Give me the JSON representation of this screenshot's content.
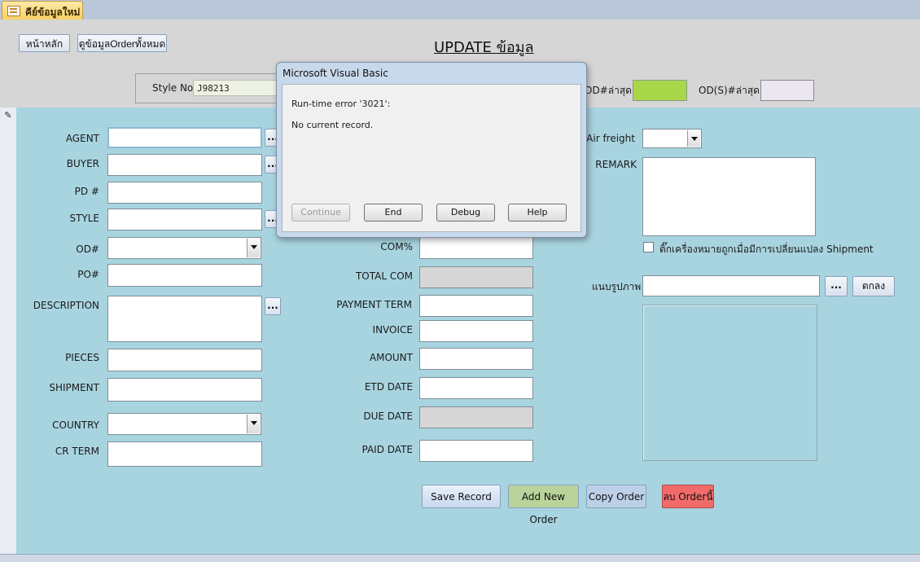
{
  "tabs": {
    "active_label": "คีย์ข้อมูลใหม่"
  },
  "header": {
    "home_button": "หน้าหลัก",
    "view_orders_button": "ดูข้อมูลOrderทั้งหมด",
    "page_title": "UPDATE ข้อมูล",
    "style_label": "Style No.",
    "style_value": "J98213",
    "od_last_label": "OD#ล่าสุด",
    "ods_last_label": "OD(S)#ล่าสุด"
  },
  "form": {
    "left": {
      "agent_label": "AGENT",
      "buyer_label": "BUYER",
      "pd_label": "PD #",
      "style_label": "STYLE",
      "od_label": "OD#",
      "po_label": "PO#",
      "description_label": "DESCRIPTION",
      "pieces_label": "PIECES",
      "shipment_label": "SHIPMENT",
      "country_label": "COUNTRY",
      "cr_term_label": "CR TERM"
    },
    "middle": {
      "com_pct_label": "COM%",
      "total_com_label": "TOTAL COM",
      "payment_term_label": "PAYMENT TERM",
      "invoice_label": "INVOICE",
      "amount_label": "AMOUNT",
      "etd_date_label": "ETD DATE",
      "due_date_label": "DUE DATE",
      "paid_date_label": "PAID DATE"
    },
    "right": {
      "air_freight_label": "Air freight",
      "remark_label": "REMARK",
      "shipment_change_checkbox_label": "ติ๊กเครื่องหมายถูกเมื่อมีการเปลี่ยนแปลง Shipment",
      "attach_image_label": "แนบรูปภาพ",
      "browse_label": "...",
      "ok_button": "ตกลง"
    },
    "dots_label": "...",
    "actions": {
      "save_record": "Save Record",
      "add_new_order": "Add New Order",
      "copy_order": "Copy Order",
      "delete_order": "ลบ Orderนี้"
    }
  },
  "dialog": {
    "title": "Microsoft Visual Basic",
    "error_code": "Run-time error '3021':",
    "message": "No current record.",
    "buttons": {
      "continue": "Continue",
      "end": "End",
      "debug": "Debug",
      "help": "Help"
    }
  },
  "colors": {
    "detail_bg": "#a8d4e0",
    "od_last_fill": "#a8d84a",
    "add_new_order_bg": "#b9d39b",
    "copy_order_bg": "#bcd0e8",
    "delete_order_bg": "#f26b6b"
  }
}
